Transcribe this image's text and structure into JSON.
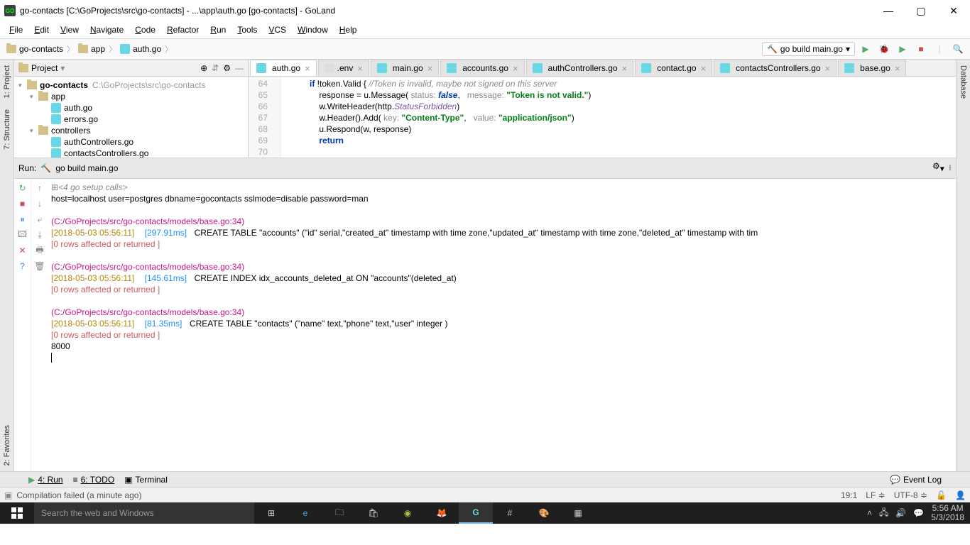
{
  "window": {
    "title": "go-contacts [C:\\GoProjects\\src\\go-contacts] - ...\\app\\auth.go [go-contacts] - GoLand",
    "app_icon_text": "GO"
  },
  "menu": [
    "File",
    "Edit",
    "View",
    "Navigate",
    "Code",
    "Refactor",
    "Run",
    "Tools",
    "VCS",
    "Window",
    "Help"
  ],
  "breadcrumbs": [
    {
      "icon": "dir",
      "label": "go-contacts"
    },
    {
      "icon": "dir",
      "label": "app"
    },
    {
      "icon": "go",
      "label": "auth.go"
    }
  ],
  "run_config": {
    "label": "go build main.go"
  },
  "left_strip": [
    {
      "label": "1: Project"
    },
    {
      "label": "7: Structure"
    },
    {
      "label": "2: Favorites"
    }
  ],
  "right_strip": [
    {
      "label": "Database"
    }
  ],
  "project_header": "Project",
  "tree": [
    {
      "indent": 0,
      "arrow": "▾",
      "icon": "dir",
      "label": "go-contacts",
      "path": "C:\\GoProjects\\src\\go-contacts"
    },
    {
      "indent": 1,
      "arrow": "▾",
      "icon": "dir",
      "label": "app"
    },
    {
      "indent": 2,
      "arrow": "",
      "icon": "go",
      "label": "auth.go"
    },
    {
      "indent": 2,
      "arrow": "",
      "icon": "go",
      "label": "errors.go"
    },
    {
      "indent": 1,
      "arrow": "▾",
      "icon": "dir",
      "label": "controllers"
    },
    {
      "indent": 2,
      "arrow": "",
      "icon": "go",
      "label": "authControllers.go"
    },
    {
      "indent": 2,
      "arrow": "",
      "icon": "go",
      "label": "contactsControllers.go"
    }
  ],
  "editor_tabs": [
    {
      "label": "auth.go",
      "active": true
    },
    {
      "label": ".env"
    },
    {
      "label": "main.go"
    },
    {
      "label": "accounts.go"
    },
    {
      "label": "authControllers.go"
    },
    {
      "label": "contact.go"
    },
    {
      "label": "contactsControllers.go"
    },
    {
      "label": "base.go"
    }
  ],
  "gutter": [
    "64",
    "65",
    "66",
    "67",
    "68",
    "69",
    "70"
  ],
  "code": {
    "l65a": "if ",
    "l65b": "!token.Valid { ",
    "l65c": "//Token is invalid, maybe not signed on this server",
    "l66a": "    response = u.Message(",
    "l66b": " status: ",
    "l66c": "false",
    "l66d": ",  ",
    "l66e": " message: ",
    "l66f": "\"Token is not valid.\"",
    "l66g": ")",
    "l67a": "    w.WriteHeader(http.",
    "l67b": "StatusForbidden",
    "l67c": ")",
    "l68a": "    w.Header().Add(",
    "l68b": " key: ",
    "l68c": "\"Content-Type\"",
    "l68d": ",  ",
    "l68e": " value: ",
    "l68f": "\"application/json\"",
    "l68g": ")",
    "l69a": "    u.Respond(w, response)",
    "l70a": "    ",
    "l70b": "return"
  },
  "run_header": {
    "title": "Run:",
    "config": "go build main.go"
  },
  "console": {
    "fold": "<4 go setup calls>",
    "conn": "host=localhost user=postgres dbname=gocontacts sslmode=disable password=man",
    "path1": "(C:/GoProjects/src/go-contacts/models/base.go:34)",
    "t1": "[2018-05-03 05:56:11]",
    "d1": "[297.91ms]",
    "sql1": " CREATE TABLE \"accounts\" (\"id\" serial,\"created_at\" timestamp with time zone,\"updated_at\" timestamp with time zone,\"deleted_at\" timestamp with tim",
    "rows": "[0 rows affected or returned ]",
    "path2": "(C:/GoProjects/src/go-contacts/models/base.go:34)",
    "t2": "[2018-05-03 05:56:11]",
    "d2": "[145.61ms]",
    "sql2": " CREATE INDEX idx_accounts_deleted_at ON \"accounts\"(deleted_at)",
    "path3": "(C:/GoProjects/src/go-contacts/models/base.go:34)",
    "t3": "[2018-05-03 05:56:11]",
    "d3": "[81.35ms]",
    "sql3": " CREATE TABLE \"contacts\" (\"name\" text,\"phone\" text,\"user\" integer )",
    "port": "8000"
  },
  "bottom_tabs": [
    "4: Run",
    "6: TODO",
    "Terminal"
  ],
  "event_log": "Event Log",
  "status": {
    "msg": "Compilation failed (a minute ago)",
    "pos": "19:1",
    "line_sep": "LF",
    "enc": "UTF-8"
  },
  "taskbar": {
    "search": "Search the web and Windows",
    "time": "5:56 AM",
    "date": "5/3/2018"
  }
}
